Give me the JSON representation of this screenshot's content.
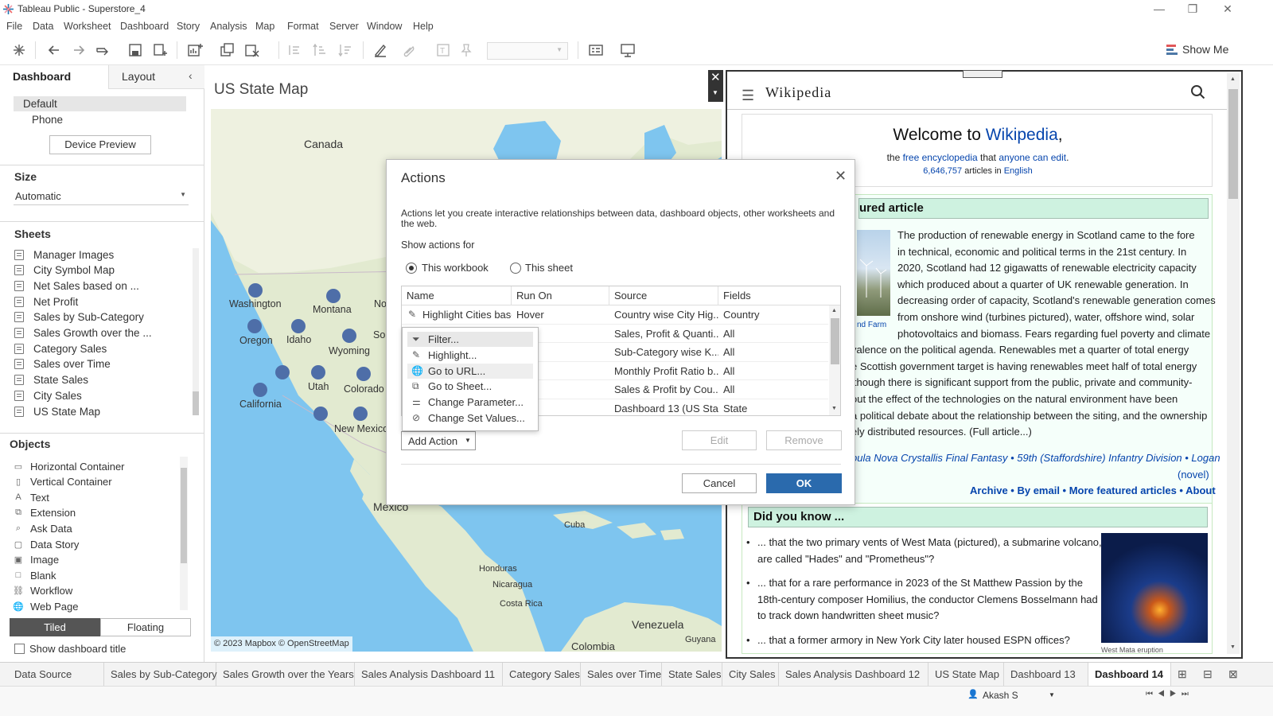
{
  "app": {
    "title": "Tableau Public - Superstore_4"
  },
  "menu": [
    "File",
    "Data",
    "Worksheet",
    "Dashboard",
    "Story",
    "Analysis",
    "Map",
    "Format",
    "Server",
    "Window",
    "Help"
  ],
  "toolbar": {
    "show_me": "Show Me"
  },
  "left_panel": {
    "tabs": [
      "Dashboard",
      "Layout"
    ],
    "devices": [
      "Default",
      "Phone"
    ],
    "device_preview": "Device Preview",
    "size_title": "Size",
    "size_value": "Automatic",
    "sheets_title": "Sheets",
    "sheets": [
      "Manager Images",
      "City Symbol Map",
      "Net Sales based on ...",
      "Net Profit",
      "Sales by Sub-Category",
      "Sales Growth over the ...",
      "Category Sales",
      "Sales over Time",
      "State Sales",
      "City Sales",
      "US State Map"
    ],
    "objects_title": "Objects",
    "objects": [
      "Horizontal Container",
      "Vertical Container",
      "Text",
      "Extension",
      "Ask Data",
      "Data Story",
      "Image",
      "Blank",
      "Workflow",
      "Web Page"
    ],
    "tiled": "Tiled",
    "floating": "Floating",
    "show_title": "Show dashboard title"
  },
  "map": {
    "title": "US State Map",
    "labels": {
      "canada": "Canada",
      "mexico": "Mexico",
      "cuba": "Cuba",
      "honduras": "Honduras",
      "nicaragua": "Nicaragua",
      "costa_rica": "Costa Rica",
      "venezuela": "Venezuela",
      "guyana": "Guyana",
      "colombia": "Colombia",
      "washington": "Washington",
      "oregon": "Oregon",
      "idaho": "Idaho",
      "montana": "Montana",
      "wyoming": "Wyoming",
      "utah": "Utah",
      "colorado": "Colorado",
      "california": "California",
      "new_mexico": "New Mexico",
      "no": "No",
      "sou": "Sou"
    },
    "attribution": "© 2023 Mapbox © OpenStreetMap"
  },
  "dialog": {
    "title": "Actions",
    "description": "Actions let you create interactive relationships between data, dashboard objects, other worksheets and the web.",
    "show_for": "Show actions for",
    "radio_workbook": "This workbook",
    "radio_sheet": "This sheet",
    "columns": [
      "Name",
      "Run On",
      "Source",
      "Fields"
    ],
    "rows": [
      [
        "Highlight Cities base",
        "Hover",
        "Country wise City Hig...",
        "Country"
      ],
      [
        "",
        "t",
        "Sales, Profit & Quanti...",
        "All"
      ],
      [
        "",
        "t",
        "Sub-Category wise K...",
        "All"
      ],
      [
        "",
        "t",
        "Monthly Profit Ratio b...",
        "All"
      ],
      [
        "",
        "t",
        "Sales & Profit by Cou...",
        "All"
      ],
      [
        "",
        "t",
        "Dashboard 13 (US Sta...",
        "State"
      ]
    ],
    "add_action": "Add Action",
    "edit": "Edit",
    "remove": "Remove",
    "cancel": "Cancel",
    "ok": "OK"
  },
  "dropdown": [
    "Filter...",
    "Highlight...",
    "Go to URL...",
    "Go to Sheet...",
    "Change Parameter...",
    "Change Set Values..."
  ],
  "wiki": {
    "logo": "Wikipedia",
    "welcome": "Welcome to ",
    "welcome_link": "Wikipedia",
    "welcome_comma": ",",
    "line2_a": "the ",
    "line2_link1": "free encyclopedia",
    "line2_b": " that ",
    "line2_link2": "anyone can edit",
    "line2_c": ".",
    "count": "6,646,757",
    "count_mid": " articles in ",
    "count_lang": "English",
    "featured_heading": "ured article",
    "image_caption": "nd Farm",
    "featured_lines": [
      "The production of renewable energy in Scotland came to the fore",
      "in technical, economic and political terms in the 21st century. In",
      "2020, Scotland had 12 gigawatts of renewable electricity capacity",
      "which produced about a quarter of UK renewable generation. In",
      "decreasing order of capacity, Scotland's renewable generation comes",
      "from onshore wind (turbines pictured), water, offshore wind, solar",
      "photovoltaics and biomass. Fears regarding fuel poverty and climate",
      "valence on the political agenda. Renewables met a quarter of total energy",
      "e Scottish government target is having renewables meet half of total energy",
      "lthough there is significant support from the public, private and community-",
      "out the effect of the technologies on the natural environment have been",
      "a political debate about the relationship between the siting, and the ownership",
      "ely distributed resources. (Full article...)"
    ],
    "recent_line1": "bula Nova Crystallis Final Fantasy • 59th (Staffordshire) Infantry Division • Logan",
    "recent_line2": "(novel)",
    "archive_links": "Archive • By email • More featured articles • About",
    "dyk_heading": "Did you know ...",
    "dyk_items": [
      [
        "... that the two primary vents of West Mata (pictured), a submarine volcano,",
        "are called \"Hades\" and \"Prometheus\"?"
      ],
      [
        "... that for a rare performance in 2023 of the St Matthew Passion by the",
        "18th-century composer Homilius, the conductor Clemens Bosselmann had",
        "to track down handwritten sheet music?"
      ],
      [
        "... that a former armory in New York City later housed ESPN offices?"
      ]
    ],
    "dyk_caption": "West Mata eruption"
  },
  "tabs": [
    "Data Source",
    "Sales by Sub-Category",
    "Sales Growth over the Years",
    "Sales Analysis Dashboard 11",
    "Category Sales",
    "Sales over Time",
    "State Sales",
    "City Sales",
    "Sales Analysis Dashboard 12",
    "US State Map",
    "Dashboard 13",
    "Dashboard 14"
  ],
  "status": {
    "user": "Akash S"
  }
}
